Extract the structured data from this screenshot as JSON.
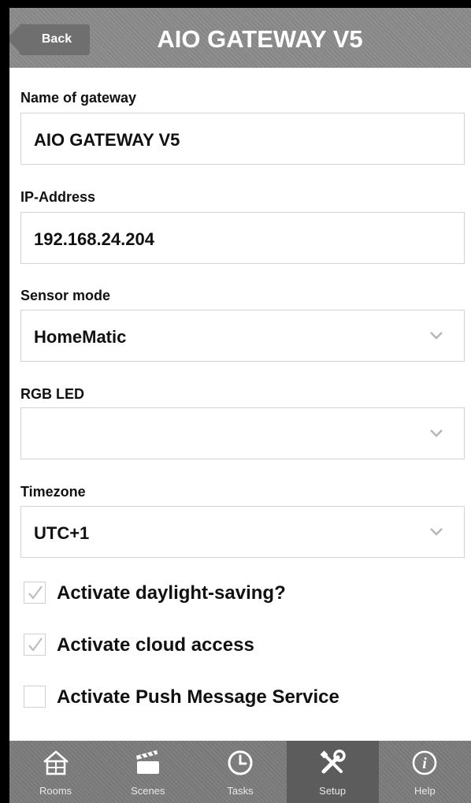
{
  "header": {
    "back_label": "Back",
    "title": "AIO GATEWAY V5"
  },
  "form": {
    "name_label": "Name of gateway",
    "name_value": "AIO GATEWAY V5",
    "ip_label": "IP-Address",
    "ip_value": "192.168.24.204",
    "sensor_label": "Sensor mode",
    "sensor_value": "HomeMatic",
    "rgb_label": "RGB LED",
    "rgb_value": "",
    "timezone_label": "Timezone",
    "timezone_value": "UTC+1"
  },
  "checkboxes": [
    {
      "label": "Activate daylight-saving?",
      "checked": true
    },
    {
      "label": "Activate cloud access",
      "checked": true
    },
    {
      "label": "Activate Push Message Service",
      "checked": false
    }
  ],
  "tabs": [
    {
      "label": "Rooms",
      "icon": "house-icon"
    },
    {
      "label": "Scenes",
      "icon": "clapperboard-icon"
    },
    {
      "label": "Tasks",
      "icon": "clock-icon"
    },
    {
      "label": "Setup",
      "icon": "tools-icon",
      "active": true
    },
    {
      "label": "Help",
      "icon": "info-icon"
    }
  ],
  "colors": {
    "header_bg": "#8a8a8a",
    "tabbar_bg": "#7c7c7c",
    "tab_active_bg": "#5c5c5c",
    "link": "#5b6fb8"
  }
}
